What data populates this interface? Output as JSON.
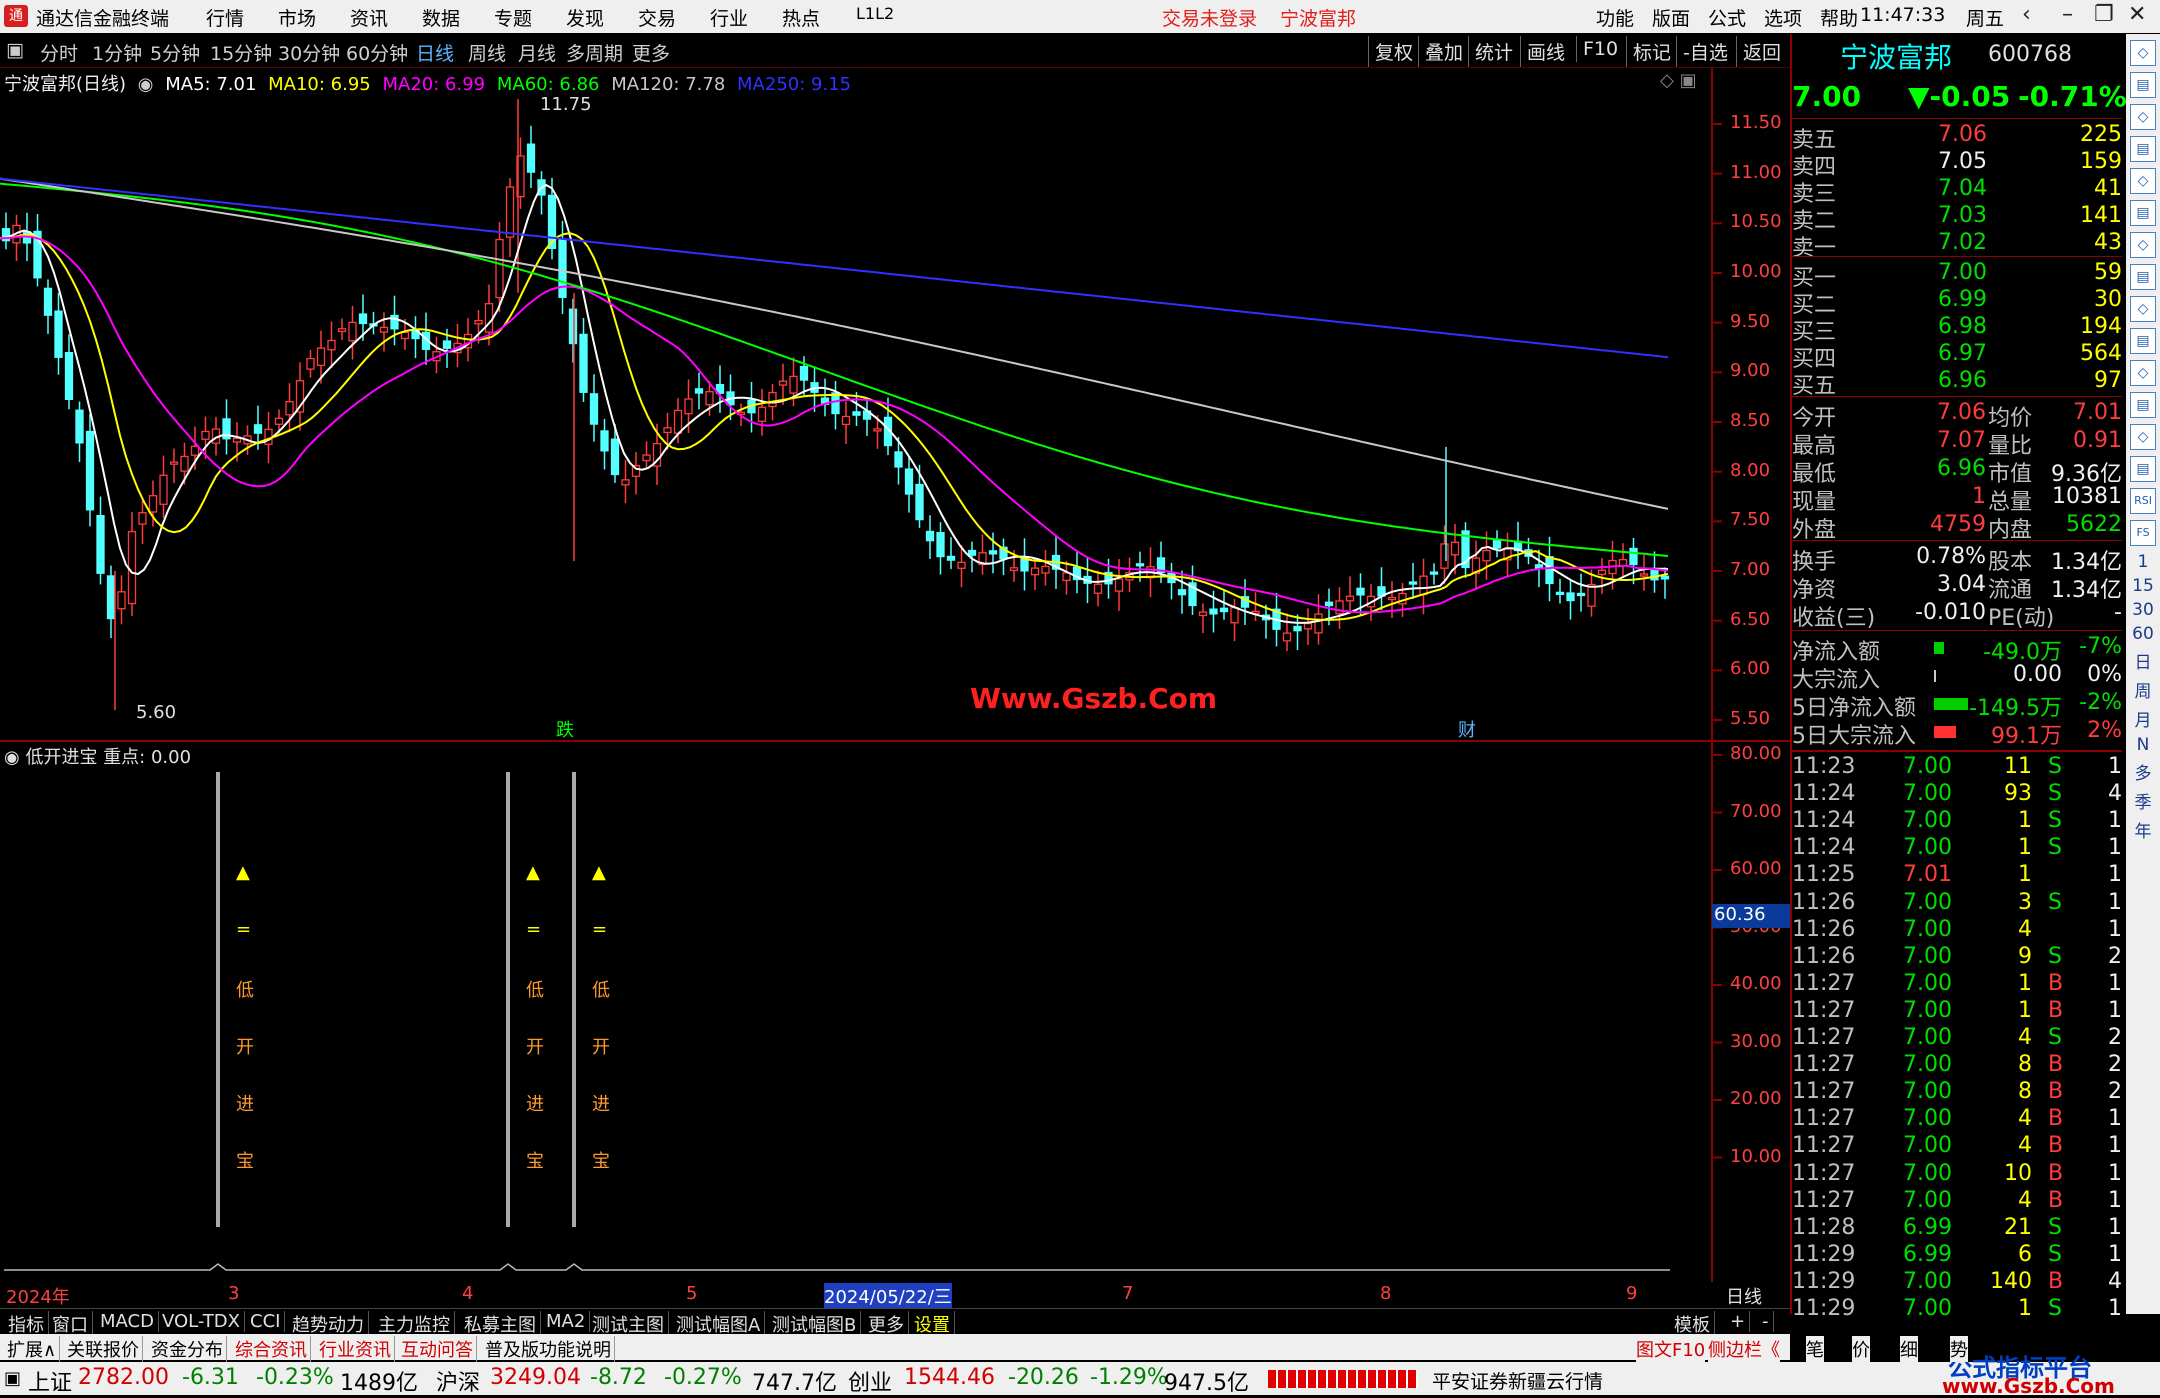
{
  "menubar": {
    "app_title": "通达信金融终端",
    "items": [
      "行情",
      "市场",
      "资讯",
      "数据",
      "专题",
      "发现",
      "交易",
      "行业",
      "热点",
      "L1L2"
    ],
    "alert1": "交易未登录",
    "alert2": "宁波富邦",
    "right": [
      "功能",
      "版面",
      "公式",
      "选项",
      "帮助"
    ],
    "time": "11:47:33",
    "weekday": "周五"
  },
  "periods": {
    "items": [
      "分时",
      "1分钟",
      "5分钟",
      "15分钟",
      "30分钟",
      "60分钟",
      "日线",
      "周线",
      "月线",
      "多周期",
      "更多"
    ],
    "active": "日线",
    "tools": [
      "复权",
      "叠加",
      "统计",
      "画线",
      "F10",
      "标记",
      "-自选",
      "返回"
    ]
  },
  "chart_info": {
    "title": "宁波富邦(日线)",
    "ma5": "MA5: 7.01",
    "ma10": "MA10: 6.95",
    "ma20": "MA20: 6.99",
    "ma60": "MA60: 6.86",
    "ma120": "MA120: 7.78",
    "ma250": "MA250: 9.15",
    "high_label": "11.75",
    "low_label": "5.60",
    "event1": "跌",
    "event2": "财",
    "watermark": "Www.Gszb.Com"
  },
  "price_axis": [
    "11.50",
    "11.00",
    "10.50",
    "10.00",
    "9.50",
    "9.00",
    "8.50",
    "8.00",
    "7.50",
    "7.00",
    "6.50",
    "6.00",
    "5.50"
  ],
  "indicator": {
    "title": "低开进宝",
    "key": "重点: 0.00",
    "axis": [
      "80.00",
      "70.00",
      "60.00",
      "50.00",
      "40.00",
      "30.00",
      "20.00",
      "10.00"
    ],
    "current": "60.36",
    "label_chars": [
      "▲",
      "=",
      "低",
      "开",
      "进",
      "宝"
    ]
  },
  "date_axis": {
    "labels": [
      "2024年",
      "3",
      "4",
      "5",
      "2024/05/22/三",
      "7",
      "8",
      "9"
    ],
    "period": "日线"
  },
  "tabs1": [
    "指标",
    "窗口",
    "MACD",
    "VOL-TDX",
    "CCI",
    "趋势动力",
    "主力监控",
    "私募主图",
    "MA2",
    "测试主图",
    "测试幅图A",
    "测试幅图B",
    "更多",
    "设置"
  ],
  "tabs1_right": [
    "模板",
    "+",
    "-"
  ],
  "tabs2": [
    "扩展∧",
    "关联报价",
    "资金分布",
    "综合资讯",
    "行业资讯",
    "互动问答",
    "普及版功能说明"
  ],
  "tabs2_right": [
    "图文F10",
    "侧边栏《",
    "笔",
    "价",
    "细",
    "势"
  ],
  "quote": {
    "name": "宁波富邦",
    "code": "600768",
    "price": "7.00",
    "change": "▼-0.05",
    "pct": "-0.71%"
  },
  "asks": [
    {
      "l": "卖五",
      "p": "7.06",
      "v": "225"
    },
    {
      "l": "卖四",
      "p": "7.05",
      "v": "159"
    },
    {
      "l": "卖三",
      "p": "7.04",
      "v": "41"
    },
    {
      "l": "卖二",
      "p": "7.03",
      "v": "141"
    },
    {
      "l": "卖一",
      "p": "7.02",
      "v": "43"
    }
  ],
  "bids": [
    {
      "l": "买一",
      "p": "7.00",
      "v": "59"
    },
    {
      "l": "买二",
      "p": "6.99",
      "v": "30"
    },
    {
      "l": "买三",
      "p": "6.98",
      "v": "194"
    },
    {
      "l": "买四",
      "p": "6.97",
      "v": "564"
    },
    {
      "l": "买五",
      "p": "6.96",
      "v": "97"
    }
  ],
  "stats": [
    {
      "a": "今开",
      "b": "7.06",
      "c": "均价",
      "d": "7.01"
    },
    {
      "a": "最高",
      "b": "7.07",
      "c": "量比",
      "d": "0.91"
    },
    {
      "a": "最低",
      "b": "6.96",
      "c": "市值",
      "d": "9.36亿"
    },
    {
      "a": "现量",
      "b": "1",
      "c": "总量",
      "d": "10381"
    },
    {
      "a": "外盘",
      "b": "4759",
      "c": "内盘",
      "d": "5622"
    },
    {
      "a": "换手",
      "b": "0.78%",
      "c": "股本",
      "d": "1.34亿"
    },
    {
      "a": "净资",
      "b": "3.04",
      "c": "流通",
      "d": "1.34亿"
    },
    {
      "a": "收益(三)",
      "b": "-0.010",
      "c": "PE(动)",
      "d": "-"
    }
  ],
  "flows": [
    {
      "a": "净流入额",
      "b": "-49.0万",
      "c": "-7%"
    },
    {
      "a": "大宗流入",
      "b": "0.00",
      "c": "0%"
    },
    {
      "a": "5日净流入额",
      "b": "-149.5万",
      "c": "-2%"
    },
    {
      "a": "5日大宗流入",
      "b": "99.1万",
      "c": "2%"
    }
  ],
  "ticks": [
    {
      "t": "11:23",
      "p": "7.00",
      "v": "11",
      "s": "S",
      "n": "1"
    },
    {
      "t": "11:24",
      "p": "7.00",
      "v": "93",
      "s": "S",
      "n": "4"
    },
    {
      "t": "11:24",
      "p": "7.00",
      "v": "1",
      "s": "S",
      "n": "1"
    },
    {
      "t": "11:24",
      "p": "7.00",
      "v": "1",
      "s": "S",
      "n": "1"
    },
    {
      "t": "11:25",
      "p": "7.01",
      "v": "1",
      "s": "",
      "n": "1"
    },
    {
      "t": "11:26",
      "p": "7.00",
      "v": "3",
      "s": "S",
      "n": "1"
    },
    {
      "t": "11:26",
      "p": "7.00",
      "v": "4",
      "s": "",
      "n": "1"
    },
    {
      "t": "11:26",
      "p": "7.00",
      "v": "9",
      "s": "S",
      "n": "2"
    },
    {
      "t": "11:27",
      "p": "7.00",
      "v": "1",
      "s": "B",
      "n": "1"
    },
    {
      "t": "11:27",
      "p": "7.00",
      "v": "1",
      "s": "B",
      "n": "1"
    },
    {
      "t": "11:27",
      "p": "7.00",
      "v": "4",
      "s": "S",
      "n": "2"
    },
    {
      "t": "11:27",
      "p": "7.00",
      "v": "8",
      "s": "B",
      "n": "2"
    },
    {
      "t": "11:27",
      "p": "7.00",
      "v": "8",
      "s": "B",
      "n": "2"
    },
    {
      "t": "11:27",
      "p": "7.00",
      "v": "4",
      "s": "B",
      "n": "1"
    },
    {
      "t": "11:27",
      "p": "7.00",
      "v": "4",
      "s": "B",
      "n": "1"
    },
    {
      "t": "11:27",
      "p": "7.00",
      "v": "10",
      "s": "B",
      "n": "1"
    },
    {
      "t": "11:27",
      "p": "7.00",
      "v": "4",
      "s": "B",
      "n": "1"
    },
    {
      "t": "11:28",
      "p": "6.99",
      "v": "21",
      "s": "S",
      "n": "1"
    },
    {
      "t": "11:29",
      "p": "6.99",
      "v": "6",
      "s": "S",
      "n": "1"
    },
    {
      "t": "11:29",
      "p": "7.00",
      "v": "140",
      "s": "B",
      "n": "4"
    },
    {
      "t": "11:29",
      "p": "7.00",
      "v": "1",
      "s": "S",
      "n": "1"
    }
  ],
  "iconbar": [
    "1",
    "15",
    "30",
    "60",
    "日",
    "周",
    "月",
    "N",
    "多",
    "季",
    "年"
  ],
  "iconbar_icons": [
    "RSI",
    "FS"
  ],
  "status": {
    "sh_name": "上证",
    "sh_val": "2782.00",
    "sh_chg": "-6.31",
    "sh_pct": "-0.23%",
    "sh_amt": "1489亿",
    "hs_name": "沪深",
    "hs_val": "3249.04",
    "hs_chg": "-8.72",
    "hs_pct": "-0.27%",
    "hs_amt": "747.7亿",
    "cy_name": "创业",
    "cy_val": "1544.46",
    "cy_chg": "-20.26",
    "cy_pct": "-1.29%",
    "cy_amt": "947.5亿",
    "broker": "平安证券新疆云行情",
    "brand1": "公式指标平台",
    "brand2": "www.Gszb.Com"
  },
  "colors": {
    "ma5": "#ffffff",
    "ma10": "#ffff00",
    "ma20": "#ff00ff",
    "ma60": "#00ff00",
    "ma120": "#c8c8c8",
    "ma250": "#3030ff",
    "up": "#ff3c3c",
    "down": "#54ffff",
    "axis": "#ff4040"
  }
}
